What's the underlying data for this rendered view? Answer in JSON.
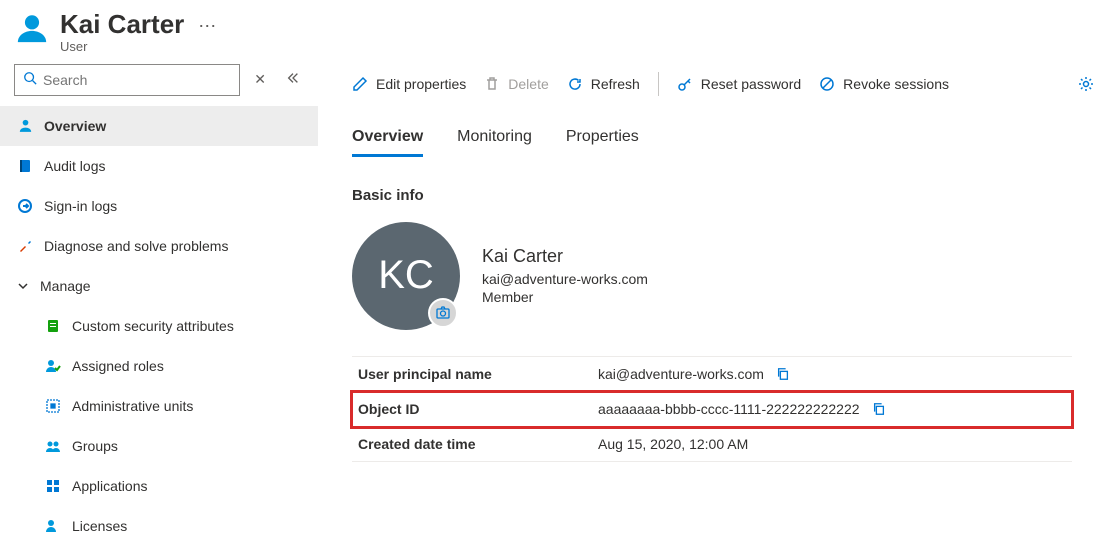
{
  "header": {
    "title": "Kai Carter",
    "subtitle": "User"
  },
  "sidebar": {
    "search_placeholder": "Search",
    "items": [
      {
        "label": "Overview"
      },
      {
        "label": "Audit logs"
      },
      {
        "label": "Sign-in logs"
      },
      {
        "label": "Diagnose and solve problems"
      },
      {
        "label": "Manage"
      },
      {
        "label": "Custom security attributes"
      },
      {
        "label": "Assigned roles"
      },
      {
        "label": "Administrative units"
      },
      {
        "label": "Groups"
      },
      {
        "label": "Applications"
      },
      {
        "label": "Licenses"
      }
    ]
  },
  "commands": {
    "edit": "Edit properties",
    "delete": "Delete",
    "refresh": "Refresh",
    "reset": "Reset password",
    "revoke": "Revoke sessions"
  },
  "tabs": {
    "overview": "Overview",
    "monitoring": "Monitoring",
    "properties": "Properties"
  },
  "basic": {
    "section": "Basic info",
    "initials": "KC",
    "name": "Kai Carter",
    "email": "kai@adventure-works.com",
    "member": "Member"
  },
  "props": {
    "upn_label": "User principal name",
    "upn_value": "kai@adventure-works.com",
    "oid_label": "Object ID",
    "oid_value": "aaaaaaaa-bbbb-cccc-1111-222222222222",
    "created_label": "Created date time",
    "created_value": "Aug 15, 2020, 12:00 AM"
  }
}
